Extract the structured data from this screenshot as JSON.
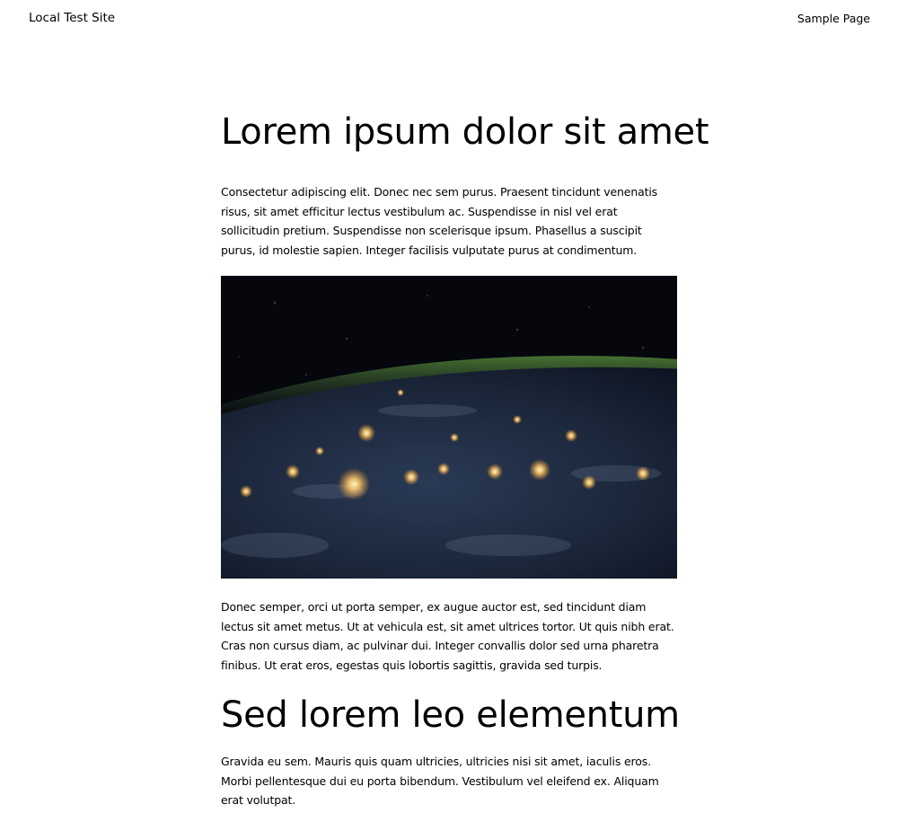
{
  "header": {
    "site_title": "Local Test Site",
    "nav": [
      {
        "label": "Sample Page"
      }
    ]
  },
  "post": {
    "title": "Lorem ipsum dolor sit amet",
    "paragraph_1": "Consectetur adipiscing elit. Donec nec sem purus. Praesent tincidunt venenatis risus, sit amet efficitur lectus vestibulum ac. Suspendisse in nisl vel erat sollicitudin pretium. Suspendisse non scelerisque ipsum. Phasellus a suscipit purus, id molestie sapien. Integer facilisis vulputate purus at condimentum.",
    "image": {
      "subject": "earth-at-night-from-orbit"
    },
    "paragraph_2": "Donec semper, orci ut porta semper, ex augue auctor est, sed tincidunt diam lectus sit amet metus. Ut at vehicula est, sit amet ultrices tortor. Ut quis nibh erat. Cras non cursus diam, ac pulvinar dui. Integer convallis dolor sed urna pharetra finibus. Ut erat eros, egestas quis lobortis sagittis, gravida sed turpis.",
    "subheading": "Sed lorem leo elementum",
    "paragraph_3": "Gravida eu sem. Mauris quis quam ultricies, ultricies nisi sit amet, iaculis eros. Morbi pellentesque dui eu porta bibendum. Vestibulum vel eleifend ex. Aliquam erat volutpat."
  },
  "colors": {
    "background": "#ffffff",
    "text": "#000000",
    "space": "#05070d",
    "earth": "#1e2a3e",
    "atmosphere": "#3d6b2e",
    "city_lights": "#ffd98a"
  }
}
